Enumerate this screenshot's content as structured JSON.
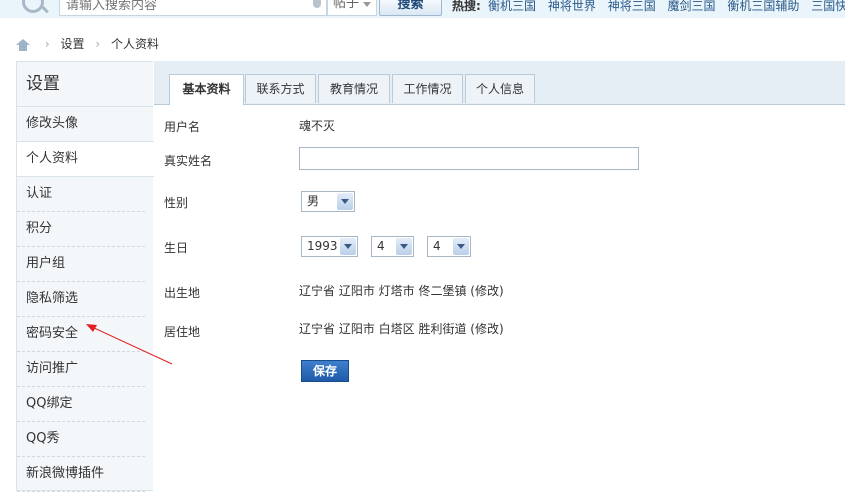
{
  "search": {
    "placeholder": "请输入搜索内容",
    "scope": "帖子",
    "button_label": "搜索",
    "hot_label": "热搜:",
    "hot_links": [
      "衡机三国",
      "神将世界",
      "神将三国",
      "魔剑三国",
      "衡机三国辅助",
      "三国快打"
    ]
  },
  "breadcrumb": {
    "items": [
      "设置",
      "个人资料"
    ]
  },
  "sidebar": {
    "title": "设置",
    "items": [
      {
        "label": "修改头像"
      },
      {
        "label": "个人资料"
      },
      {
        "label": "认证"
      },
      {
        "label": "积分"
      },
      {
        "label": "用户组"
      },
      {
        "label": "隐私筛选"
      },
      {
        "label": "密码安全"
      },
      {
        "label": "访问推广"
      },
      {
        "label": "QQ绑定"
      },
      {
        "label": "QQ秀"
      },
      {
        "label": "新浪微博插件"
      }
    ]
  },
  "tabs": [
    {
      "label": "基本资料"
    },
    {
      "label": "联系方式"
    },
    {
      "label": "教育情况"
    },
    {
      "label": "工作情况"
    },
    {
      "label": "个人信息"
    }
  ],
  "form": {
    "username_label": "用户名",
    "username_value": "魂不灭",
    "realname_label": "真实姓名",
    "realname_value": "",
    "gender_label": "性别",
    "gender_value": "男",
    "birthday_label": "生日",
    "birth_year": "1993",
    "birth_month": "4",
    "birth_day": "4",
    "birthplace_label": "出生地",
    "birthplace_value": "辽宁省 辽阳市 灯塔市 佟二堡镇",
    "residence_label": "居住地",
    "residence_value": "辽宁省 辽阳市 白塔区 胜利街道",
    "edit_label": "(修改)",
    "save_label": "保存"
  },
  "colors": {
    "accent": "#1f5aa8",
    "annotation_arrow": "#e02020"
  }
}
